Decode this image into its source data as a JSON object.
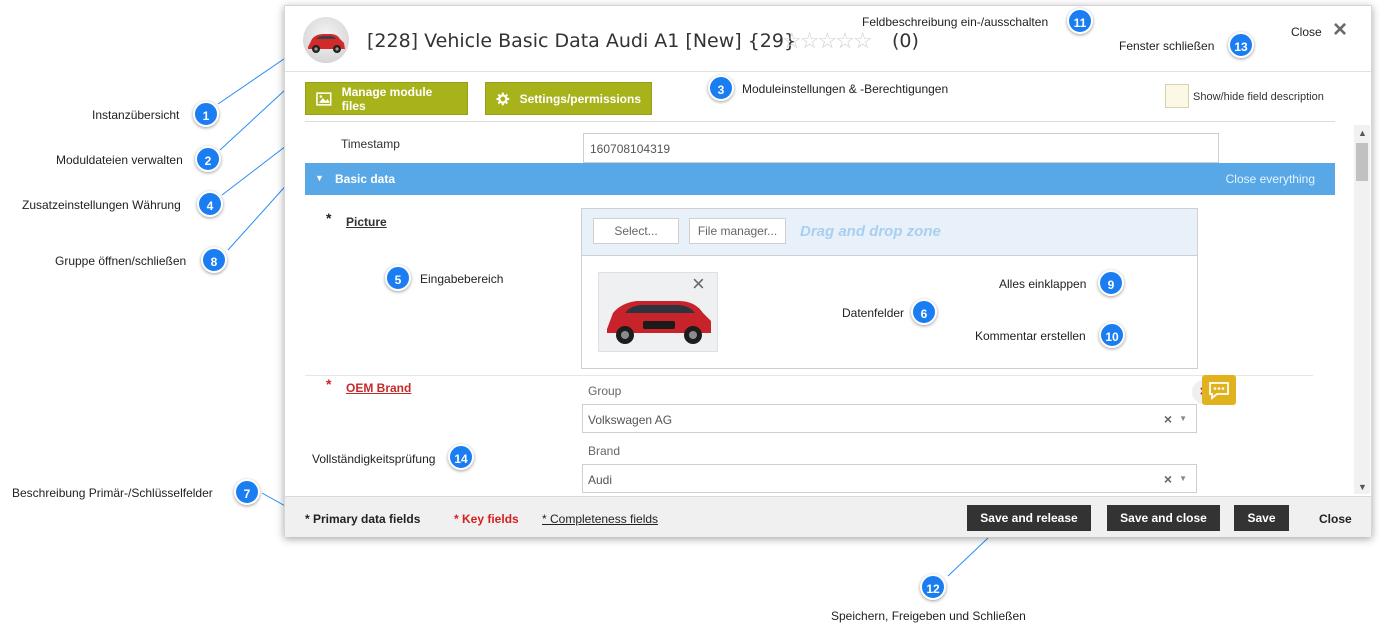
{
  "header": {
    "title": "[228] Vehicle Basic Data Audi A1 [New] {29}",
    "stars": "☆☆☆☆☆",
    "rating_count": "(0)",
    "close_icon": "×"
  },
  "toolbar": {
    "manage_files_label": "Manage module files",
    "settings_label": "Settings/permissions",
    "toggle_description_label": "Show/hide field description"
  },
  "fields": {
    "timestamp_label": "Timestamp",
    "timestamp_value": "160708104319",
    "group_title": "Basic data",
    "close_everything": "Close everything",
    "picture_label": "Picture",
    "select_button": "Select...",
    "file_manager_button": "File manager...",
    "dropzone_text": "Drag and drop zone",
    "required_mark": "*",
    "oem_brand_label": "OEM Brand",
    "group_sub_label": "Group",
    "group_value": "Volkswagen AG",
    "brand_sub_label": "Brand",
    "brand_value": "Audi"
  },
  "footer": {
    "primary_fields": "* Primary data fields",
    "key_fields": "* Key fields",
    "completeness_fields": "* Completeness fields",
    "save_release": "Save and release",
    "save_close": "Save and close",
    "save": "Save",
    "close": "Close"
  },
  "callouts": [
    {
      "n": "1",
      "text": "Instanzübersicht"
    },
    {
      "n": "2",
      "text": "Moduldateien verwalten"
    },
    {
      "n": "3",
      "text": "Moduleinstellungen & -Berechtigungen"
    },
    {
      "n": "4",
      "text": "Zusatzeinstellungen Währung"
    },
    {
      "n": "5",
      "text": "Eingabebereich"
    },
    {
      "n": "6",
      "text": "Datenfelder"
    },
    {
      "n": "7",
      "text": "Beschreibung Primär-/Schlüsselfelder"
    },
    {
      "n": "8",
      "text": "Gruppe öffnen/schließen"
    },
    {
      "n": "9",
      "text": "Alles einklappen"
    },
    {
      "n": "10",
      "text": "Kommentar erstellen"
    },
    {
      "n": "11",
      "text": "Feldbeschreibung ein-/ausschalten"
    },
    {
      "n": "12",
      "text": "Speichern, Freigeben und Schließen"
    },
    {
      "n": "13",
      "text": "Fenster schließen"
    },
    {
      "n": "14",
      "text": "Vollständigkeitsprüfung"
    }
  ],
  "close_caption": "Close",
  "colors": {
    "accent_green": "#a8b31c",
    "group_blue": "#58a8e8",
    "callout_blue": "#1a7ef2",
    "key_red": "#d62020",
    "comment_yellow": "#e0b21e"
  }
}
